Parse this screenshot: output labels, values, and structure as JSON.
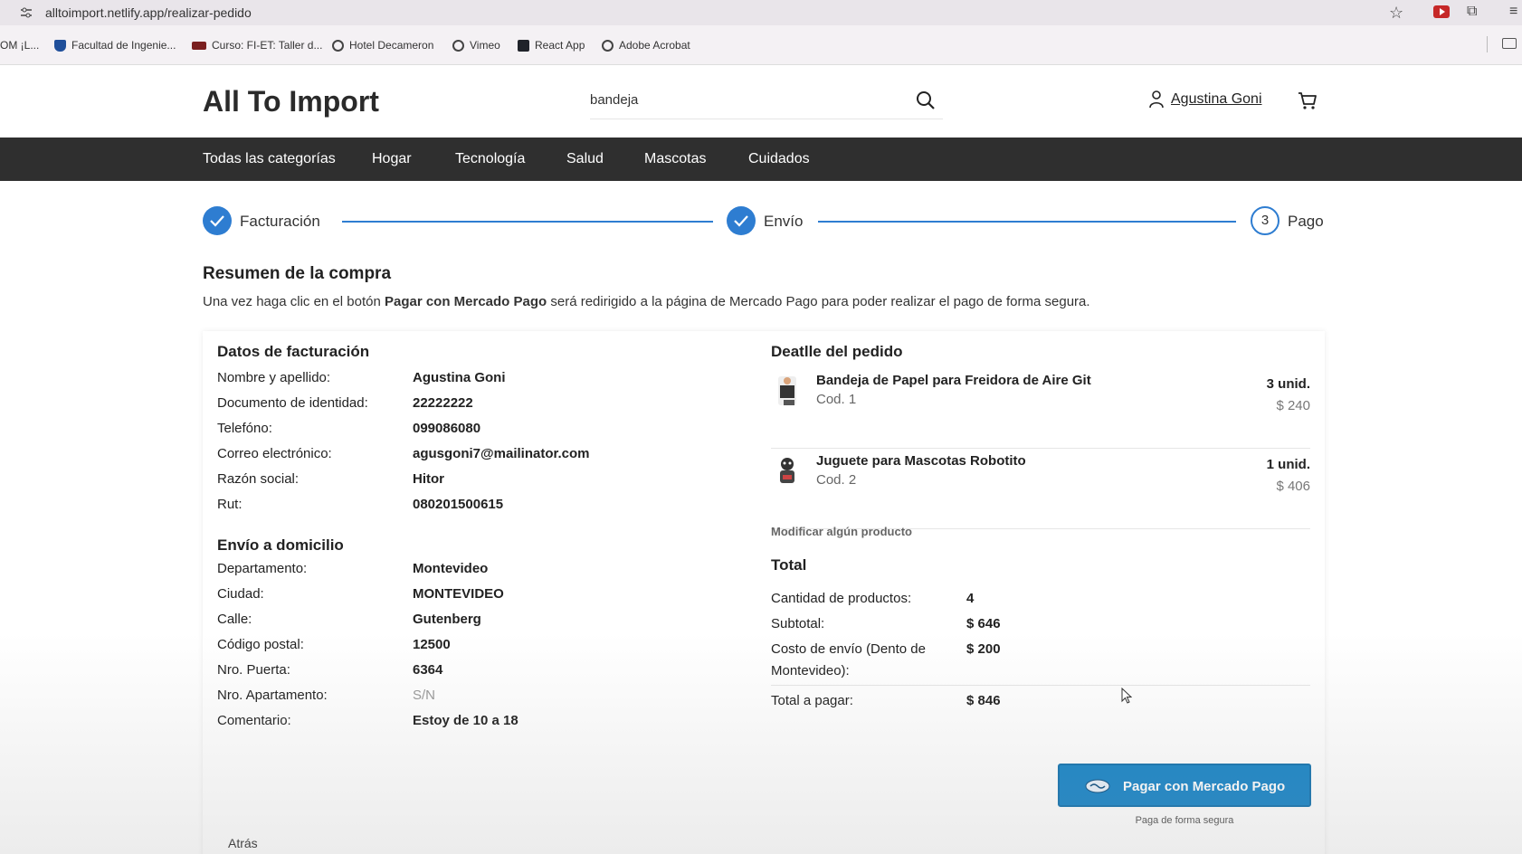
{
  "browser": {
    "url": "alltoimport.netlify.app/realizar-pedido",
    "bookmarks": [
      "OM ¡L...",
      "Facultad de Ingenie...",
      "Curso: FI-ET: Taller d...",
      "Hotel Decameron",
      "Vimeo",
      "React App",
      "Adobe Acrobat"
    ]
  },
  "header": {
    "logo": "All To Import",
    "search_value": "bandeja",
    "user_name": "Agustina Goni"
  },
  "nav": [
    "Todas las categorías",
    "Hogar",
    "Tecnología",
    "Salud",
    "Mascotas",
    "Cuidados"
  ],
  "stepper": {
    "step1": "Facturación",
    "step2": "Envío",
    "step3": "Pago",
    "step3_number": "3"
  },
  "summary": {
    "title": "Resumen de la compra",
    "desc_before": "Una vez haga clic en el botón ",
    "desc_bold": "Pagar con Mercado Pago",
    "desc_after": " será redirigido a la página de Mercado Pago para poder realizar el pago de forma segura."
  },
  "billing": {
    "title": "Datos de facturación",
    "rows": [
      {
        "k": "Nombre y apellido:",
        "v": "Agustina Goni"
      },
      {
        "k": "Documento de identidad:",
        "v": "22222222"
      },
      {
        "k": "Telefóno:",
        "v": "099086080"
      },
      {
        "k": "Correo electrónico:",
        "v": "agusgoni7@mailinator.com"
      },
      {
        "k": "Razón social:",
        "v": "Hitor"
      },
      {
        "k": "Rut:",
        "v": "080201500615"
      }
    ]
  },
  "shipping": {
    "title": "Envío a domicilio",
    "rows": [
      {
        "k": "Departamento:",
        "v": "Montevideo"
      },
      {
        "k": "Ciudad:",
        "v": "MONTEVIDEO"
      },
      {
        "k": "Calle:",
        "v": "Gutenberg"
      },
      {
        "k": "Código postal:",
        "v": "12500"
      },
      {
        "k": "Nro. Puerta:",
        "v": "6364"
      },
      {
        "k": "Nro. Apartamento:",
        "v": "S/N"
      },
      {
        "k": "Comentario:",
        "v": "Estoy de 10 a 18"
      }
    ]
  },
  "order": {
    "title": "Deatlle del pedido",
    "items": [
      {
        "name": "Bandeja de Papel para Freidora de Aire Git",
        "code": "Cod. 1",
        "qty": "3 unid.",
        "price": "$ 240"
      },
      {
        "name": "Juguete para Mascotas Robotito",
        "code": "Cod. 2",
        "qty": "1 unid.",
        "price": "$ 406"
      }
    ],
    "modify": "Modificar algún producto"
  },
  "total": {
    "title": "Total",
    "rows": [
      {
        "k": "Cantidad de productos:",
        "v": "4"
      },
      {
        "k": "Subtotal:",
        "v": "$ 646"
      },
      {
        "k": "Costo de envío (Dento de Montevideo):",
        "v": "$ 200"
      },
      {
        "k": "Total a pagar:",
        "v": "$ 846"
      }
    ]
  },
  "pay": {
    "label": "Pagar con Mercado Pago",
    "secure": "Paga de forma segura",
    "brand_color": "#1a86c8"
  },
  "back": "Atrás",
  "colors": {
    "accent": "#2e7dd1",
    "nav_bg": "#2f2f2f"
  }
}
